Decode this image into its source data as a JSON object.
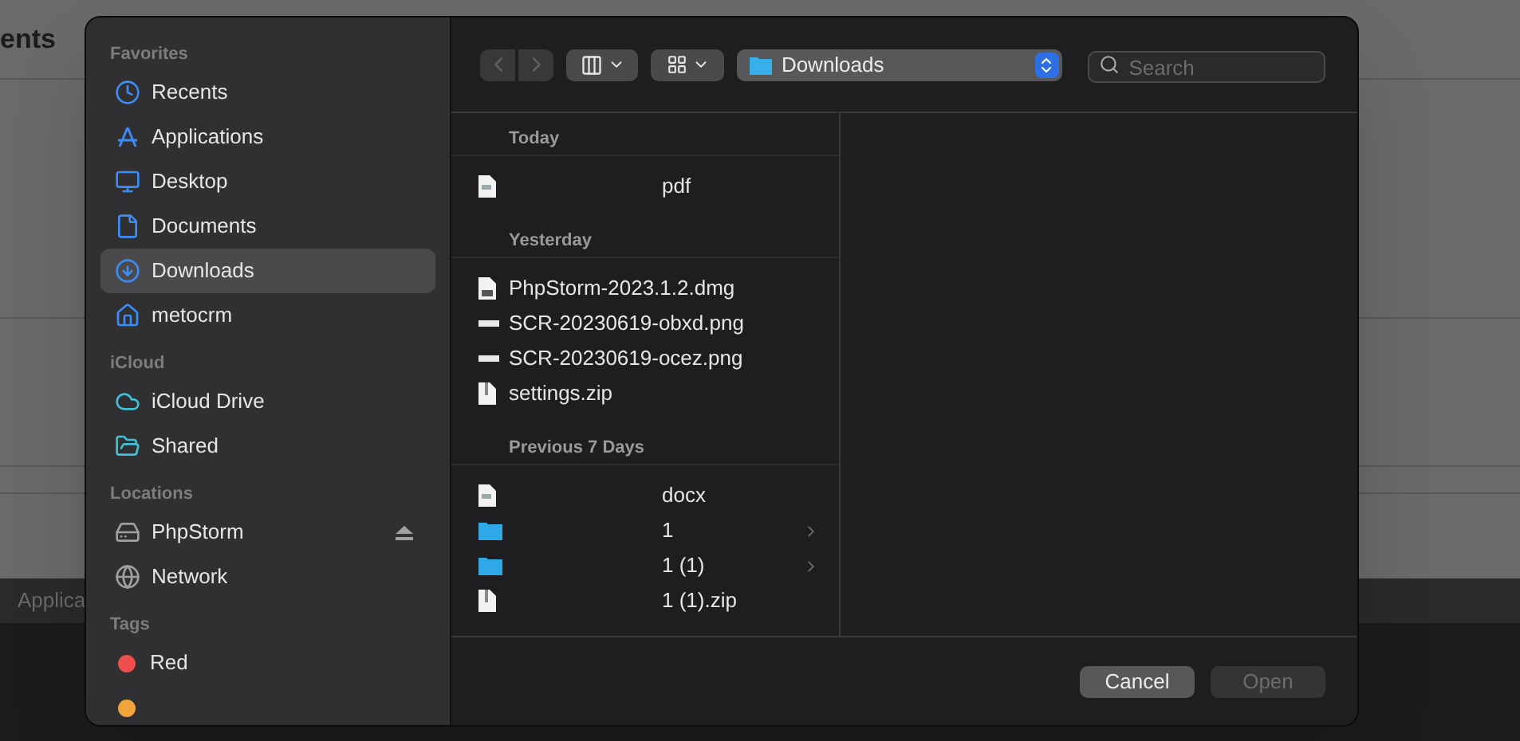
{
  "background": {
    "title": "ents",
    "footer_tab": "Applica"
  },
  "sidebar": {
    "sections": [
      {
        "heading": "Favorites",
        "items": [
          {
            "label": "Recents",
            "selected": false
          },
          {
            "label": "Applications",
            "selected": false
          },
          {
            "label": "Desktop",
            "selected": false
          },
          {
            "label": "Documents",
            "selected": false
          },
          {
            "label": "Downloads",
            "selected": true
          },
          {
            "label": "metocrm",
            "selected": false
          }
        ]
      },
      {
        "heading": "iCloud",
        "items": [
          {
            "label": "iCloud Drive",
            "selected": false
          },
          {
            "label": "Shared",
            "selected": false
          }
        ]
      },
      {
        "heading": "Locations",
        "items": [
          {
            "label": "PhpStorm",
            "selected": false,
            "ejectable": true
          },
          {
            "label": "Network",
            "selected": false
          }
        ]
      }
    ],
    "tags": {
      "heading": "Tags",
      "items": [
        {
          "label": "Red",
          "color": "#ee4f4a"
        },
        {
          "color": "#f0a43a"
        }
      ]
    }
  },
  "toolbar": {
    "back_disabled": true,
    "forward_disabled": true,
    "location": "Downloads",
    "search": {
      "placeholder": "Search"
    }
  },
  "files": [
    {
      "heading": "Today",
      "rows": [
        {
          "name": "pdf",
          "kind": "document",
          "indented": true
        }
      ]
    },
    {
      "heading": "Yesterday",
      "rows": [
        {
          "name": "PhpStorm-2023.1.2.dmg",
          "kind": "disk-image",
          "indented": false
        },
        {
          "name": "SCR-20230619-obxd.png",
          "kind": "image",
          "indented": false
        },
        {
          "name": "SCR-20230619-ocez.png",
          "kind": "image",
          "indented": false
        },
        {
          "name": "settings.zip",
          "kind": "archive",
          "indented": false
        }
      ]
    },
    {
      "heading": "Previous 7 Days",
      "rows": [
        {
          "name": "docx",
          "kind": "document",
          "indented": true
        },
        {
          "name": "1",
          "kind": "folder",
          "indented": true
        },
        {
          "name": "1 (1)",
          "kind": "folder",
          "indented": true
        },
        {
          "name": "1 (1).zip",
          "kind": "archive",
          "indented": true
        }
      ]
    }
  ],
  "buttons": [
    {
      "label": "Cancel",
      "disabled": false
    },
    {
      "label": "Open",
      "disabled": true
    }
  ]
}
